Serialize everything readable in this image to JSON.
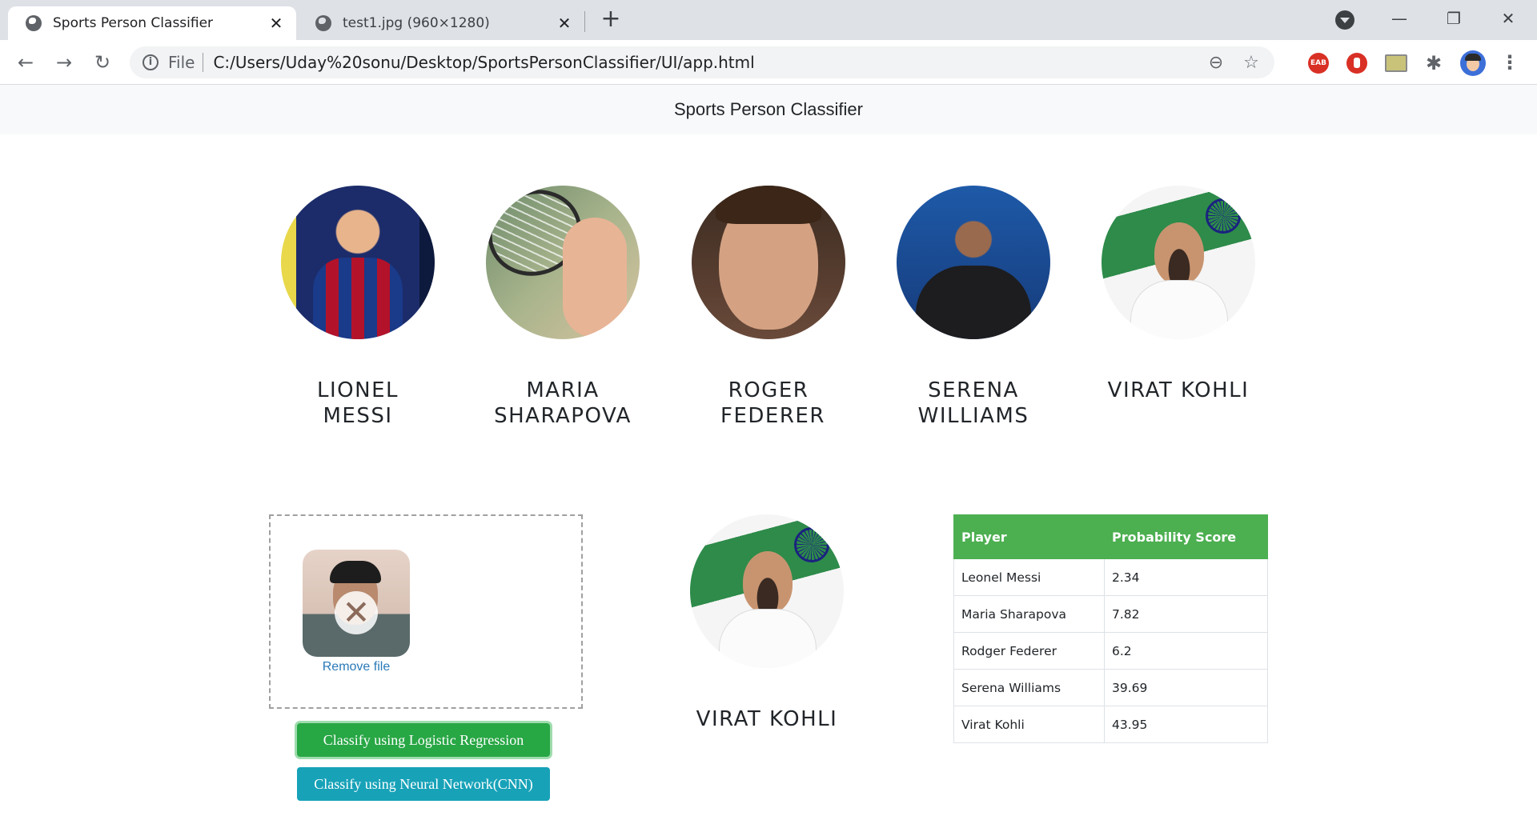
{
  "browser": {
    "tabs": [
      {
        "title": "Sports Person Classifier",
        "close": "✕"
      },
      {
        "title": "test1.jpg (960×1280)",
        "close": "✕"
      }
    ],
    "new_tab": "+",
    "window_controls": {
      "minimize": "—",
      "restore": "❐",
      "close": "✕"
    },
    "nav": {
      "back": "←",
      "forward": "→",
      "reload": "↻"
    },
    "address": {
      "scheme": "File",
      "url": "C:/Users/Uday%20sonu/Desktop/SportsPersonClassifier/UI/app.html"
    },
    "address_icons": [
      "zoom-out-icon",
      "star-icon"
    ],
    "extensions": {
      "eab": "EAB",
      "puzzle": "✱"
    },
    "menu": "⋮"
  },
  "header": {
    "title": "Sports Person Classifier"
  },
  "players": [
    {
      "name": "LIONEL MESSI"
    },
    {
      "name": "MARIA SHARAPOVA"
    },
    {
      "name": "ROGER FEDERER"
    },
    {
      "name": "SERENA WILLIAMS"
    },
    {
      "name": "VIRAT KOHLI"
    }
  ],
  "upload": {
    "remove_label": "Remove file",
    "remove_glyph": "✕"
  },
  "buttons": {
    "logistic": "Classify using Logistic Regression",
    "cnn": "Classify using Neural Network(CNN)"
  },
  "result": {
    "name": "VIRAT KOHLI"
  },
  "table": {
    "headers": [
      "Player",
      "Probability Score"
    ],
    "rows": [
      [
        "Leonel Messi",
        "2.34"
      ],
      [
        "Maria Sharapova",
        "7.82"
      ],
      [
        "Rodger Federer",
        "6.2"
      ],
      [
        "Serena Williams",
        "39.69"
      ],
      [
        "Virat Kohli",
        "43.95"
      ]
    ]
  },
  "colors": {
    "success": "#28a745",
    "info": "#17a2b8",
    "table_header": "#4caf50"
  }
}
